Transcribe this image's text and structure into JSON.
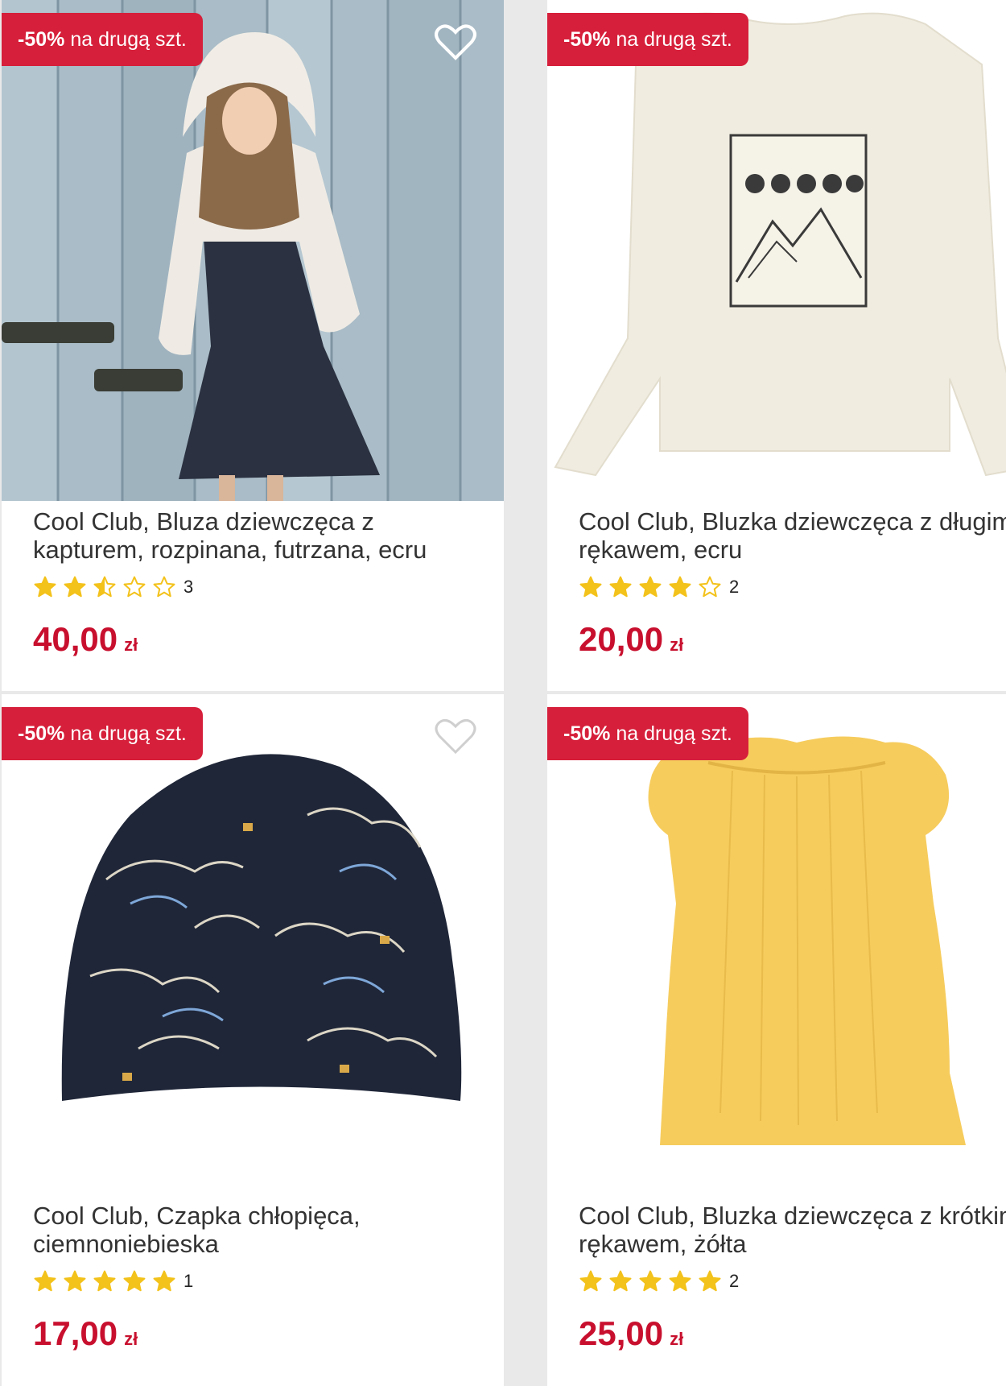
{
  "colors": {
    "accent": "#d61f3a",
    "price": "#c8102e",
    "star": "#f3c21b"
  },
  "products": [
    {
      "badge_pct": "-50%",
      "badge_text": "na drugą szt.",
      "title": "Cool Club, Bluza dziewczęca z kapturem, rozpinana, futrzana, ecru",
      "rating": 2.5,
      "review_count": "3",
      "price": "40,00",
      "currency": "zł",
      "favorite_icon": "heart-outline-icon",
      "image": "girl in white hooded fleece jacket"
    },
    {
      "badge_pct": "-50%",
      "badge_text": "na drugą szt.",
      "title": "Cool Club, Bluzka dziewczęca z długim rękawem, ecru",
      "rating": 4,
      "review_count": "2",
      "price": "20,00",
      "currency": "zł",
      "favorite_icon": "heart-outline-icon",
      "image": "ecru long sleeve top with mountain print"
    },
    {
      "badge_pct": "-50%",
      "badge_text": "na drugą szt.",
      "title": "Cool Club, Czapka chłopięca, ciemnoniebieska",
      "rating": 5,
      "review_count": "1",
      "price": "17,00",
      "currency": "zł",
      "favorite_icon": "heart-outline-icon",
      "image": "navy beanie with dinosaur print"
    },
    {
      "badge_pct": "-50%",
      "badge_text": "na drugą szt.",
      "title": "Cool Club, Bluzka dziewczęca z krótkim rękawem, żółta",
      "rating": 5,
      "review_count": "2",
      "price": "25,00",
      "currency": "zł",
      "favorite_icon": "heart-outline-icon",
      "image": "yellow short sleeve blouse"
    }
  ]
}
